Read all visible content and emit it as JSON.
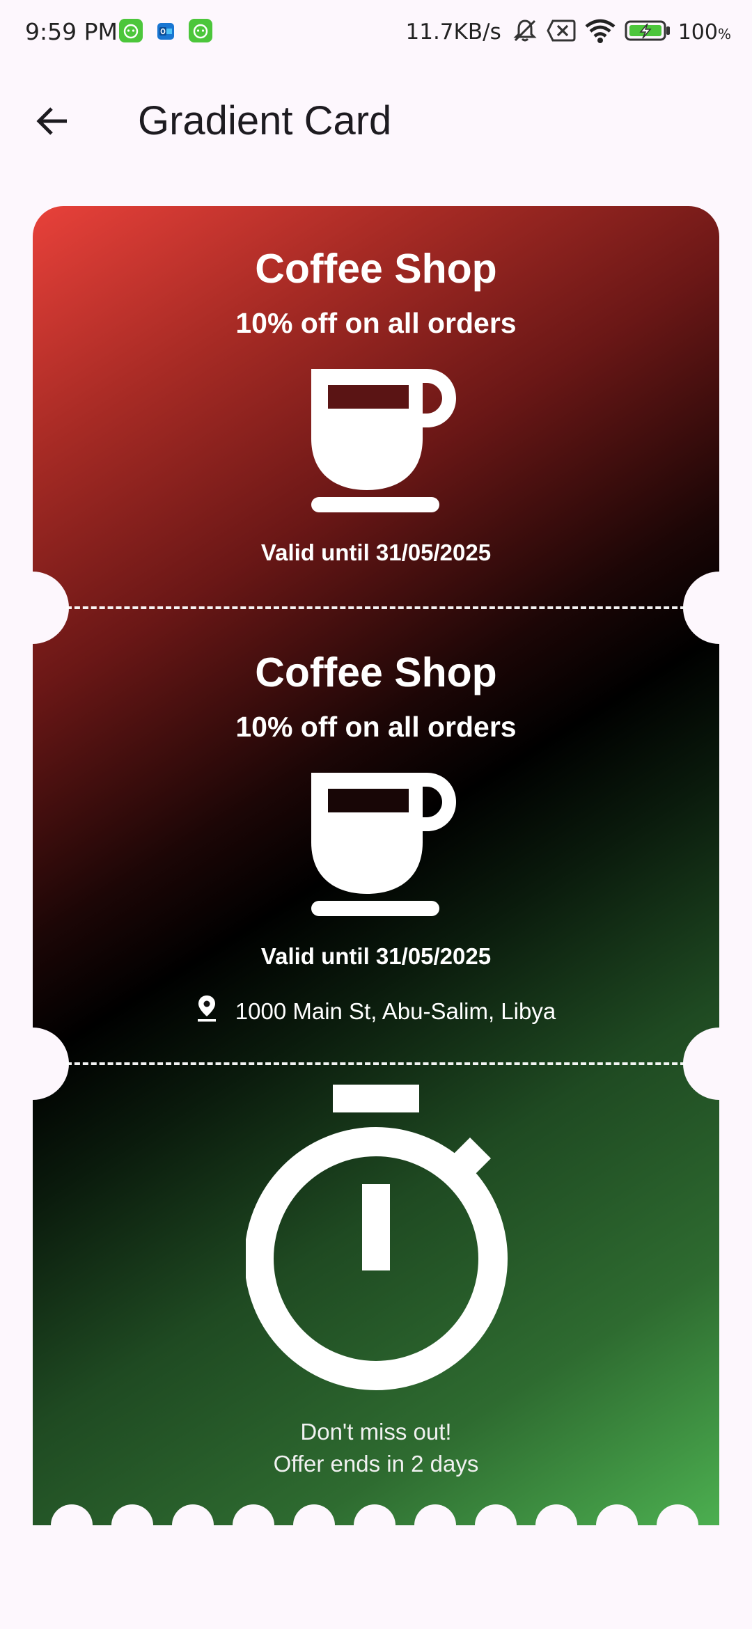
{
  "status_bar": {
    "time": "9:59 PM",
    "network_speed": "11.7KB/s",
    "battery_percent": "100",
    "battery_unit": "%",
    "icons": [
      "cat-app-icon",
      "outlook-icon",
      "cat-app-icon",
      "mute-bell-icon",
      "sim-off-icon",
      "wifi-icon",
      "battery-charging-icon"
    ]
  },
  "app_bar": {
    "title": "Gradient Card",
    "back_icon": "arrow-back-icon"
  },
  "ticket": {
    "colors": {
      "gradient_start": "#e8413a",
      "gradient_middle": "#000000",
      "gradient_end": "#4caf50",
      "text": "#ffffff"
    },
    "top": {
      "shop": "Coffee Shop",
      "offer": "10% off on all orders",
      "icon": "coffee-cup-icon",
      "valid": "Valid until 31/05/2025"
    },
    "middle": {
      "shop": "Coffee Shop",
      "offer": "10% off on all orders",
      "icon": "coffee-cup-icon",
      "valid": "Valid until 31/05/2025",
      "address_icon": "location-pin-icon",
      "address": "1000 Main St, Abu-Salim, Libya"
    },
    "bottom": {
      "icon": "stopwatch-icon",
      "line1": "Don't miss out!",
      "line2": "Offer ends in 2 days"
    }
  }
}
